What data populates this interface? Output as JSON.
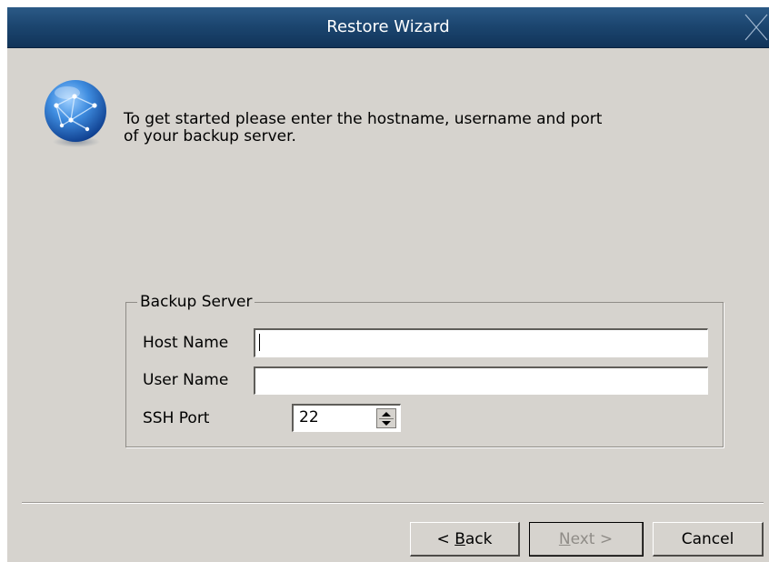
{
  "window": {
    "title": "Restore Wizard"
  },
  "header": {
    "icon": "globe-network-icon",
    "intro_line1": "To get started please enter the hostname, username and port",
    "intro_line2": "of your backup server."
  },
  "backup_server": {
    "group_title": "Backup Server",
    "host_label": "Host Name",
    "host_value": "",
    "user_label": "User Name",
    "user_value": "",
    "port_label": "SSH Port",
    "port_value": "22"
  },
  "buttons": {
    "back_prefix": "< ",
    "back_mnemonic": "B",
    "back_rest": "ack",
    "next_mnemonic": "N",
    "next_rest": "ext >",
    "next_enabled": false,
    "cancel": "Cancel"
  },
  "colors": {
    "titlebar": "#1c4670",
    "dialog_bg": "#d6d3ce",
    "disabled_text": "#8f8c87"
  }
}
